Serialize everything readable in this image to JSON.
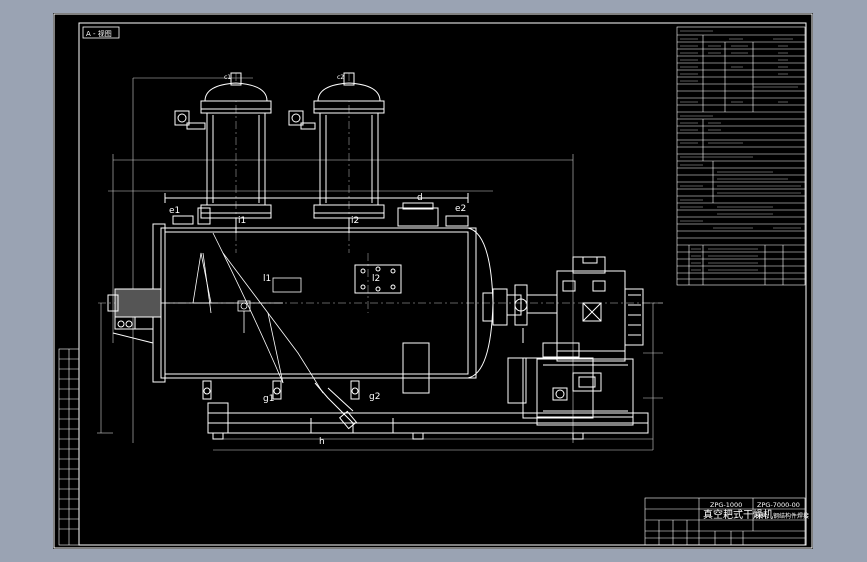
{
  "drawing": {
    "view_label": "A - 视图",
    "title_project_code": "ZPG-1000",
    "title_drawing_code": "ZPG-7000-00",
    "title_name": "真空耙式干燥机",
    "title_note": "材料：钢结构件焊接",
    "nozzles": [
      "e1",
      "e2",
      "d",
      "c1",
      "c2",
      "g1",
      "g2",
      "h",
      "i1",
      "i2",
      "l1",
      "l2"
    ]
  },
  "colors": {
    "background": "#9aa3b3",
    "sheet": "#000000",
    "linework": "#ffffff",
    "dimension": "#cfcfcf",
    "center": "#bfbfbf"
  }
}
